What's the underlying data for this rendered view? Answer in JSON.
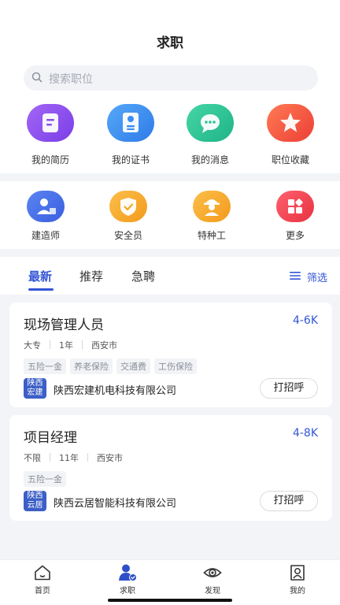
{
  "header": {
    "title": "求职"
  },
  "search": {
    "placeholder": "搜索职位"
  },
  "quick_actions": [
    {
      "label": "我的简历",
      "icon": "resume-icon",
      "color": "#8a4ff0"
    },
    {
      "label": "我的证书",
      "icon": "certificate-icon",
      "color": "#3a8ef0"
    },
    {
      "label": "我的消息",
      "icon": "message-icon",
      "color": "#2ec296"
    },
    {
      "label": "职位收藏",
      "icon": "star-icon",
      "color": "#f2553d"
    }
  ],
  "categories": [
    {
      "label": "建造师",
      "icon": "builder-icon",
      "color": "#4169e6"
    },
    {
      "label": "安全员",
      "icon": "shield-icon",
      "color": "#f5a623"
    },
    {
      "label": "特种工",
      "icon": "worker-icon",
      "color": "#f5a623"
    },
    {
      "label": "更多",
      "icon": "more-apps-icon",
      "color": "#f0414d"
    }
  ],
  "tabs": {
    "items": [
      "最新",
      "推荐",
      "急聘"
    ],
    "active": "最新",
    "filter_label": "筛选"
  },
  "jobs": [
    {
      "title": "现场管理人员",
      "salary": "4-6K",
      "meta": [
        "大专",
        "1年",
        "西安市"
      ],
      "tags": [
        "五险一金",
        "养老保险",
        "交通费",
        "工伤保险"
      ],
      "logo_text": [
        "陕西",
        "宏建"
      ],
      "company": "陕西宏建机电科技有限公司",
      "action": "打招呼"
    },
    {
      "title": "项目经理",
      "salary": "4-8K",
      "meta": [
        "不限",
        "11年",
        "西安市"
      ],
      "tags": [
        "五险一金"
      ],
      "logo_text": [
        "陕西",
        "云居"
      ],
      "company": "陕西云居智能科技有限公司",
      "action": "打招呼"
    }
  ],
  "bottom_nav": [
    {
      "label": "首页",
      "icon": "home-icon"
    },
    {
      "label": "求职",
      "icon": "job-seeker-icon",
      "active": true
    },
    {
      "label": "发现",
      "icon": "eye-icon"
    },
    {
      "label": "我的",
      "icon": "profile-icon"
    }
  ],
  "colors": {
    "accent": "#3355d6",
    "background": "#f2f4f8"
  }
}
